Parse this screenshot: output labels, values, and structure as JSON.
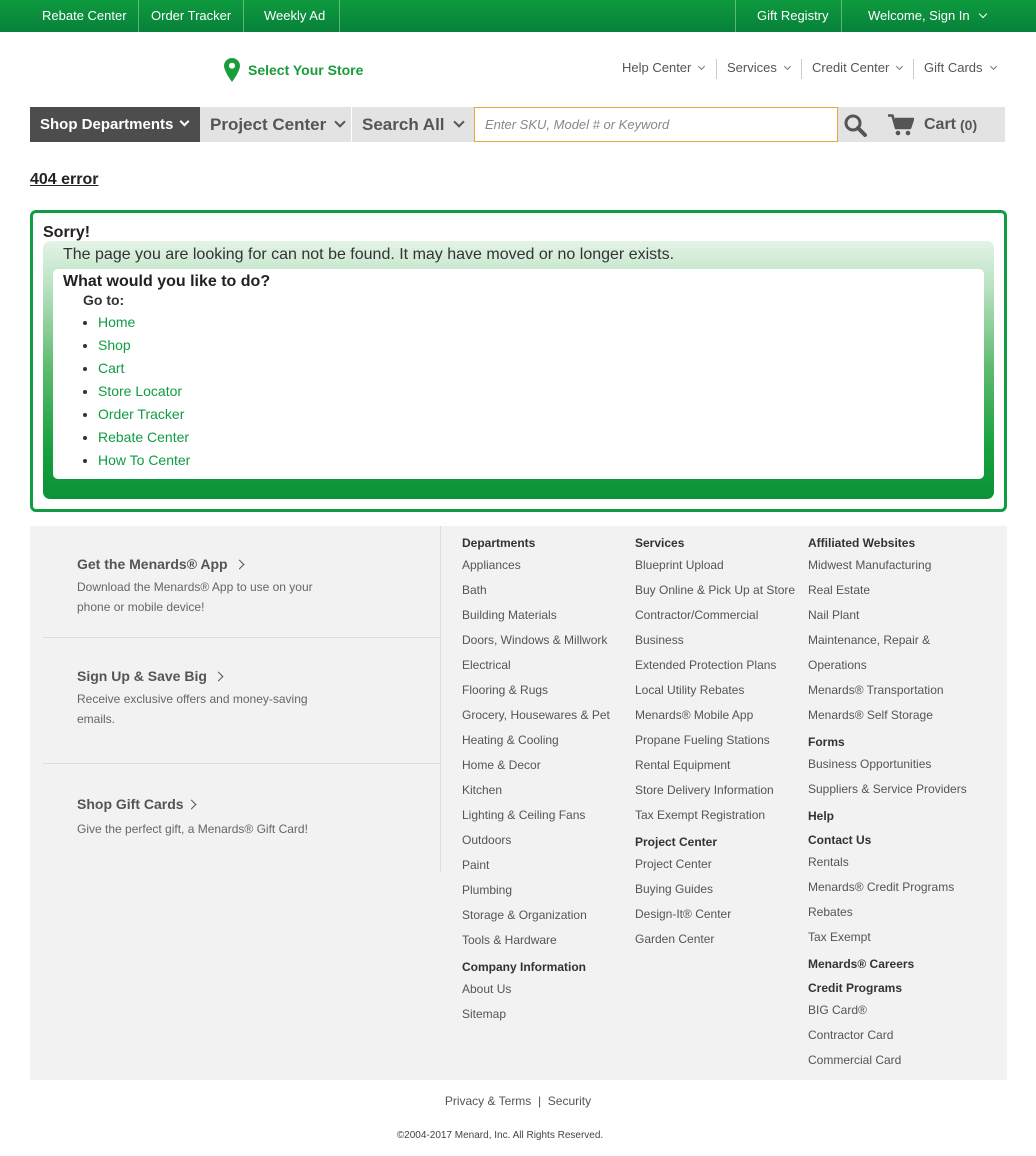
{
  "topbar": {
    "rebate": "Rebate Center",
    "order": "Order Tracker",
    "weekly": "Weekly Ad",
    "registry": "Gift Registry",
    "welcome": "Welcome, Sign In"
  },
  "header": {
    "store": "Select Your Store",
    "util": [
      "Help Center",
      "Services",
      "Credit Center",
      "Gift Cards"
    ]
  },
  "nav": {
    "departments": "Shop Departments",
    "project": "Project Center",
    "search_all": "Search All",
    "search_placeholder": "Enter SKU, Model # or Keyword",
    "cart_label": "Cart",
    "cart_count": "(0)"
  },
  "error": {
    "title": "404 error",
    "sorry": "Sorry!",
    "message": "The page you are looking for can not be found. It may have moved or no longer exists.",
    "question": "What would you like to do?",
    "goto": "Go to:",
    "links": [
      "Home",
      "Shop",
      "Cart",
      "Store Locator",
      "Order Tracker",
      "Rebate Center",
      "How To Center"
    ]
  },
  "footer": {
    "promos": [
      {
        "title": "Get the Menards® App",
        "text": "Download the Menards® App to use on your phone or mobile device!"
      },
      {
        "title": "Sign Up & Save Big",
        "text": "Receive exclusive offers and money-saving emails."
      },
      {
        "title": "Shop Gift Cards",
        "text": "Give the perfect gift, a Menards® Gift Card!"
      }
    ],
    "departments": {
      "heading": "Departments",
      "items": [
        "Appliances",
        "Bath",
        "Building Materials",
        "Doors, Windows & Millwork",
        "Electrical",
        "Flooring & Rugs",
        "Grocery, Housewares & Pet",
        "Heating & Cooling",
        "Home & Decor",
        "Kitchen",
        "Lighting & Ceiling Fans",
        "Outdoors",
        "Paint",
        "Plumbing",
        "Storage & Organization",
        "Tools & Hardware"
      ],
      "company_heading": "Company Information",
      "company_items": [
        "About Us",
        "Sitemap"
      ]
    },
    "services": {
      "heading": "Services",
      "items": [
        "Blueprint Upload",
        "Buy Online & Pick Up at Store",
        "Contractor/Commercial",
        "Business",
        "Extended Protection Plans",
        "Local Utility Rebates",
        "Menards® Mobile App",
        "Propane Fueling Stations",
        "Rental Equipment",
        "Store Delivery Information",
        "Tax Exempt Registration"
      ],
      "project_heading": "Project Center",
      "project_items": [
        "Project Center",
        "Buying Guides",
        "Design-It® Center",
        "Garden Center"
      ]
    },
    "affiliated": {
      "heading": "Affiliated Websites",
      "items": [
        "Midwest Manufacturing",
        "Real Estate",
        "Nail Plant",
        "Maintenance, Repair & Operations",
        "Menards® Transportation",
        "Menards® Self Storage"
      ],
      "forms_heading": "Forms",
      "forms_items": [
        "Business Opportunities",
        "Suppliers & Service Providers"
      ],
      "help_heading": "Help",
      "contact_heading": "Contact Us",
      "contact_items": [
        "Rentals",
        "Menards® Credit Programs",
        "Rebates",
        "Tax Exempt"
      ],
      "careers_heading": "Menards® Careers",
      "credit_heading": "Credit Programs",
      "credit_items": [
        "BIG Card®",
        "Contractor Card",
        "Commercial Card"
      ]
    },
    "legal": {
      "privacy": "Privacy & Terms",
      "separator": "|",
      "security": "Security"
    },
    "copyright": "©2004-2017 Menard, Inc. All Rights Reserved."
  },
  "colors": {
    "brand_green": "#109c43",
    "topbar_green": "#0e9a3e",
    "nav_dark": "#4d4d4d",
    "search_border": "#e6a73c"
  }
}
